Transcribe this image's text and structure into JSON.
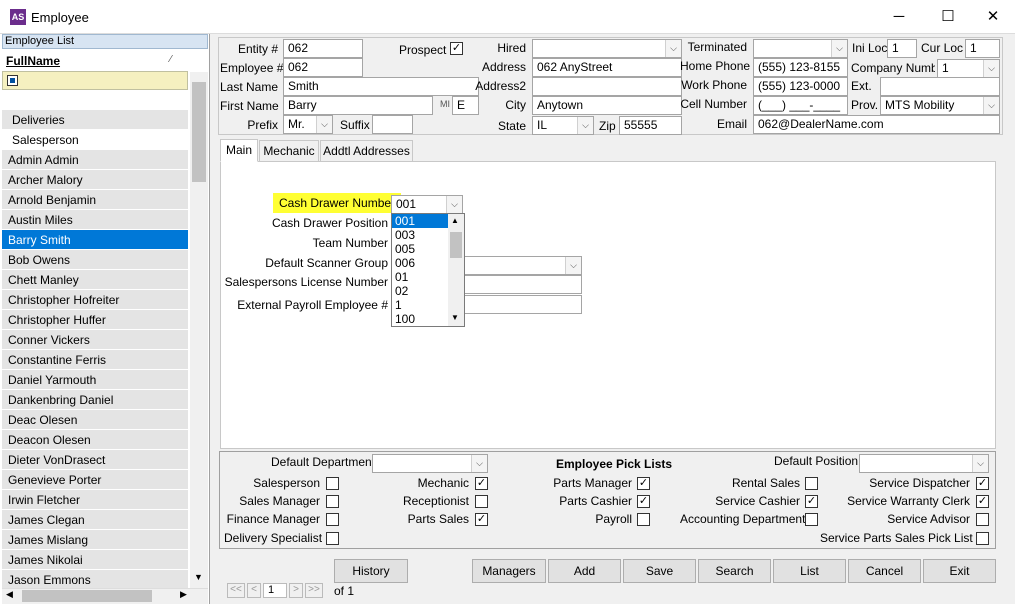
{
  "window": {
    "title": "Employee",
    "icon": "AS",
    "minimize": "─",
    "maximize": "☐",
    "close": "✕"
  },
  "sidebar": {
    "header": "Employee List",
    "column_header": "FullName",
    "items": [
      {
        "label": "Deliveries"
      },
      {
        "label": "Salesperson"
      },
      {
        "label": "Admin Admin"
      },
      {
        "label": "Archer Malory"
      },
      {
        "label": "Arnold Benjamin"
      },
      {
        "label": "Austin Miles"
      },
      {
        "label": "Barry Smith"
      },
      {
        "label": "Bob Owens"
      },
      {
        "label": "Chett Manley"
      },
      {
        "label": "Christopher Hofreiter"
      },
      {
        "label": "Christopher Huffer"
      },
      {
        "label": "Conner Vickers"
      },
      {
        "label": "Constantine Ferris"
      },
      {
        "label": "Daniel Yarmouth"
      },
      {
        "label": "Dankenbring Daniel"
      },
      {
        "label": "Deac Olesen"
      },
      {
        "label": "Deacon Olesen"
      },
      {
        "label": "Dieter VonDrasect"
      },
      {
        "label": "Genevieve Porter"
      },
      {
        "label": "Irwin Fletcher"
      },
      {
        "label": "James Clegan"
      },
      {
        "label": "James Mislang"
      },
      {
        "label": "James Nikolai"
      },
      {
        "label": "Jason Emmons"
      }
    ]
  },
  "header": {
    "entity_label": "Entity #",
    "entity": "062",
    "employee_label": "Employee #",
    "employee": "062",
    "last_name_label": "Last Name",
    "last_name": "Smith",
    "first_name_label": "First Name",
    "first_name": "Barry",
    "mi_label": "MI",
    "mi": "E",
    "prefix_label": "Prefix",
    "prefix": "Mr.",
    "suffix_label": "Suffix",
    "suffix": "",
    "prospect_label": "Prospect",
    "prospect_checked": "✓",
    "hired_label": "Hired",
    "hired": "",
    "address_label": "Address",
    "address": "062 AnyStreet",
    "address2_label": "Address2",
    "address2": "",
    "city_label": "City",
    "city": "Anytown",
    "state_label": "State",
    "state": "IL",
    "zip_label": "Zip",
    "zip": "55555",
    "terminated_label": "Terminated",
    "terminated": "",
    "home_phone_label": "Home Phone",
    "home_phone": "(555) 123-8155",
    "work_phone_label": "Work Phone",
    "work_phone": "(555) 123-0000",
    "cell_label": "Cell Number",
    "cell": "(___) ___-____",
    "email_label": "Email",
    "email": "062@DealerName.com",
    "ini_loc_label": "Ini Loc",
    "ini_loc": "1",
    "cur_loc_label": "Cur Loc",
    "cur_loc": "1",
    "company_label": "Company Numbe",
    "company": "1",
    "ext_label": "Ext.",
    "ext": "",
    "prov_label": "Prov.",
    "prov": "MTS Mobility"
  },
  "tabs": [
    {
      "label": "Main"
    },
    {
      "label": "Mechanic"
    },
    {
      "label": "Addtl Addresses"
    }
  ],
  "main": {
    "cash_drawer_label": "Cash Drawer Number",
    "cash_drawer": "001",
    "cash_drawer_pos_label": "Cash Drawer Position",
    "team_label": "Team Number",
    "scanner_label": "Default Scanner Group",
    "license_label": "Salespersons License Number",
    "payroll_label": "External Payroll Employee #",
    "dropdown_options": [
      "001",
      "003",
      "005",
      "006",
      "01",
      "02",
      "1",
      "100"
    ]
  },
  "picklists": {
    "default_dept_label": "Default Department:",
    "title": "Employee Pick Lists",
    "default_pos_label": "Default Position",
    "items": [
      {
        "label": "Salesperson",
        "checked": ""
      },
      {
        "label": "Sales Manager",
        "checked": ""
      },
      {
        "label": "Finance Manager",
        "checked": ""
      },
      {
        "label": "Delivery Specialist",
        "checked": ""
      },
      {
        "label": "Mechanic",
        "checked": "✓"
      },
      {
        "label": "Receptionist",
        "checked": ""
      },
      {
        "label": "Parts Sales",
        "checked": "✓"
      },
      {
        "label": "Parts Manager",
        "checked": "✓"
      },
      {
        "label": "Parts Cashier",
        "checked": "✓"
      },
      {
        "label": "Payroll",
        "checked": ""
      },
      {
        "label": "Rental Sales",
        "checked": ""
      },
      {
        "label": "Service Cashier",
        "checked": "✓"
      },
      {
        "label": "Accounting Department",
        "checked": ""
      },
      {
        "label": "Service Dispatcher",
        "checked": "✓"
      },
      {
        "label": "Service Warranty Clerk",
        "checked": "✓"
      },
      {
        "label": "Service Advisor",
        "checked": ""
      },
      {
        "label": "Service Parts Sales Pick List",
        "checked": ""
      }
    ]
  },
  "buttons": {
    "history": "History",
    "managers": "Managers",
    "add": "Add",
    "save": "Save",
    "search": "Search",
    "list": "List",
    "cancel": "Cancel",
    "exit": "Exit"
  },
  "pager": {
    "first": "<<",
    "prev": "<",
    "page": "1",
    "next": ">",
    "last": ">>",
    "of": "of 1"
  }
}
